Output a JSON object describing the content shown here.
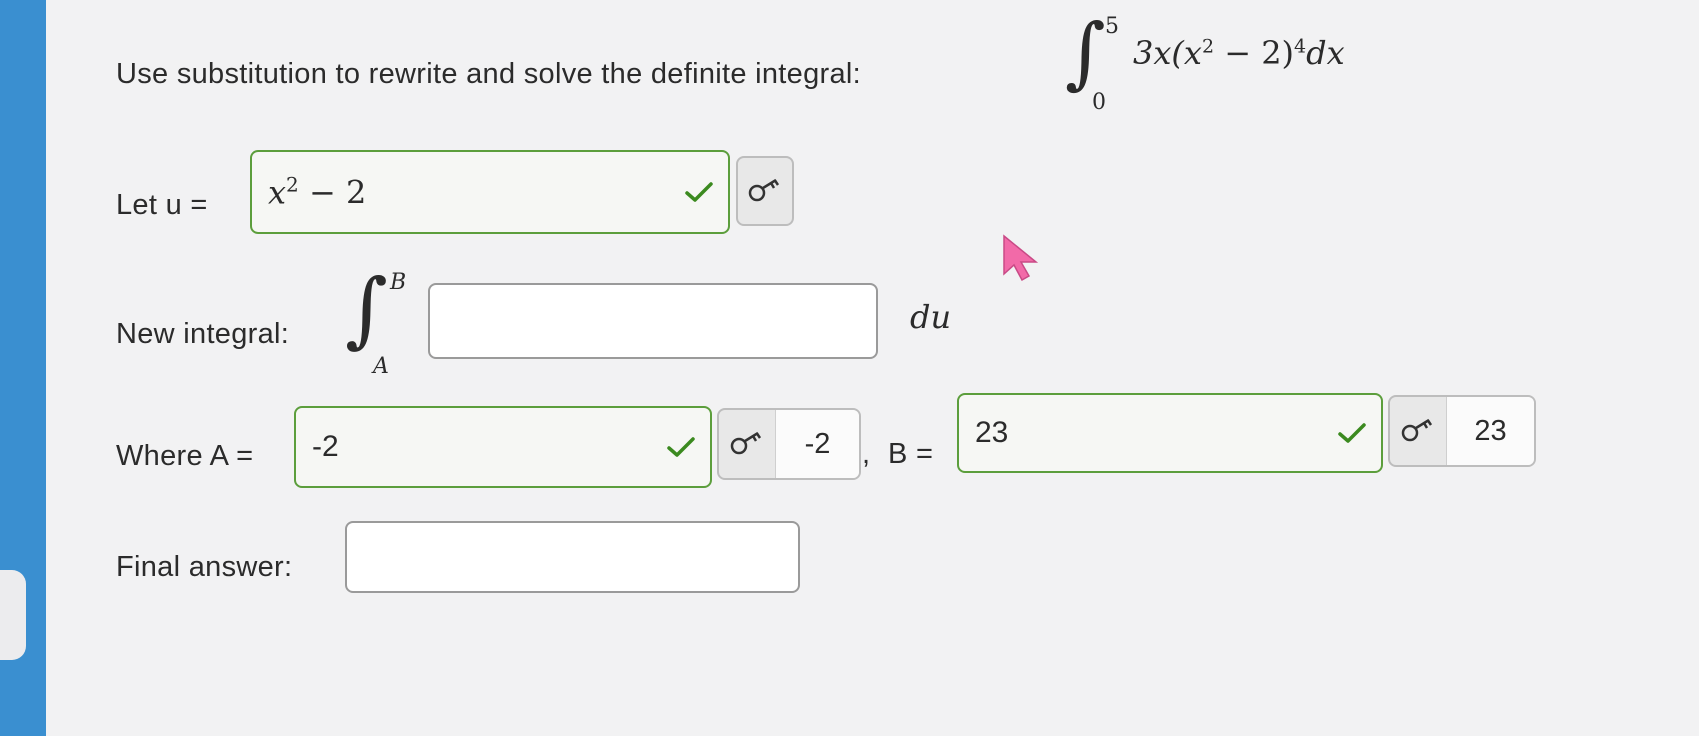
{
  "question": {
    "prompt": "Use substitution to rewrite and solve the definite integral:",
    "integral": {
      "lower": "0",
      "upper": "5",
      "integrand": "3x(x",
      "exp_inner": "2",
      "mid": " − 2)",
      "exp_outer": "4",
      "dx": "dx"
    }
  },
  "let_u": {
    "label": "Let u =",
    "value_base": "x",
    "value_exp": "2",
    "value_rest": " − 2"
  },
  "new_integral": {
    "label": "New integral:",
    "lower": "A",
    "upper": "B",
    "du": "du",
    "input_value": ""
  },
  "where": {
    "label_a": "Where A =",
    "a_value": "-2",
    "a_preview": "-2",
    "separator": ",",
    "label_b": "B =",
    "b_value": "23",
    "b_preview": "23"
  },
  "final": {
    "label": "Final answer:",
    "input_value": ""
  },
  "colors": {
    "correct_border": "#5c9e3c",
    "check_green": "#3b8a1f",
    "cursor_pink": "#f26aa8",
    "left_strip": "#3a8fd0"
  },
  "icons": [
    "check-icon",
    "key-icon",
    "mouse-cursor-icon"
  ]
}
